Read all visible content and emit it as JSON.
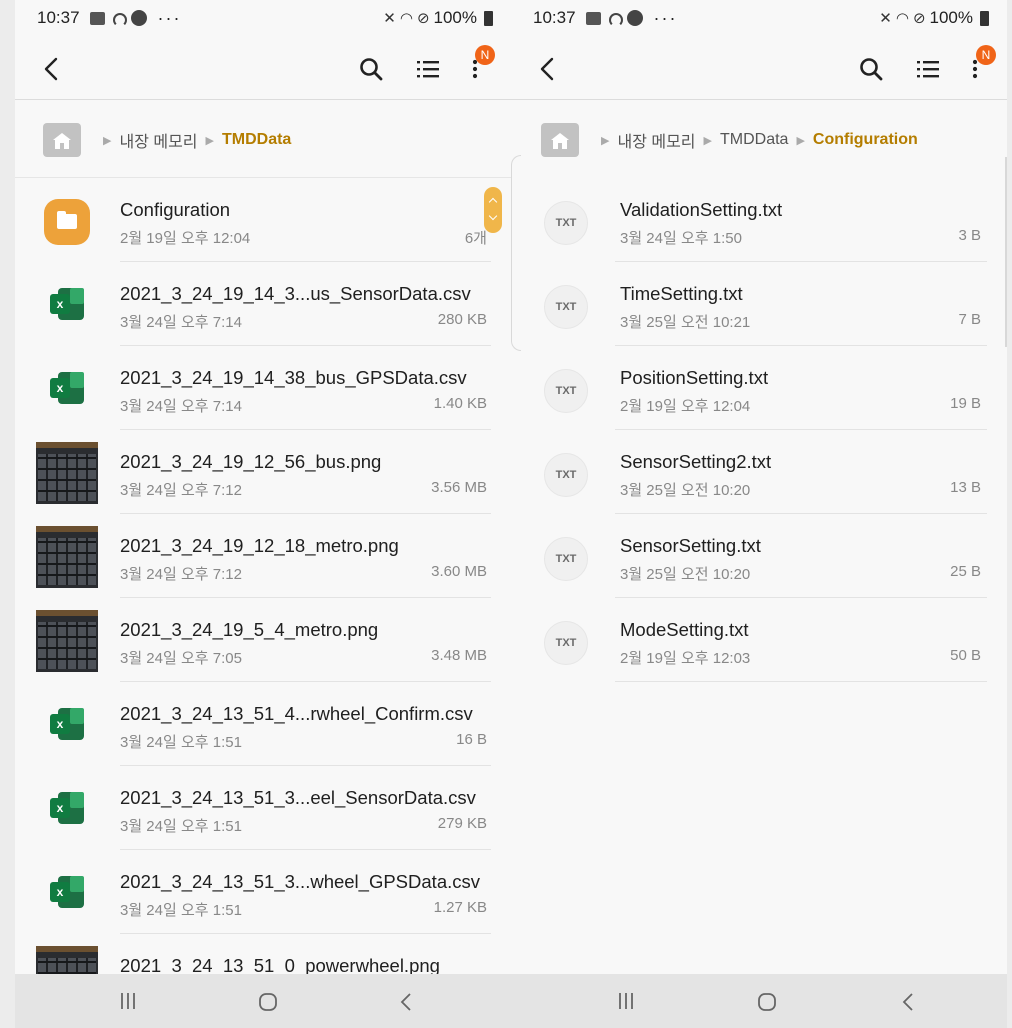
{
  "left": {
    "status": {
      "time": "10:37",
      "battery": "100%"
    },
    "toolbar": {
      "badge": "N"
    },
    "breadcrumb": {
      "root": "내장 메모리",
      "current": "TMDData"
    },
    "files": [
      {
        "type": "folder",
        "name": "Configuration",
        "date": "2월 19일 오후 12:04",
        "size": "6개"
      },
      {
        "type": "excel",
        "name": "2021_3_24_19_14_3...us_SensorData.csv",
        "date": "3월 24일 오후 7:14",
        "size": "280 KB"
      },
      {
        "type": "excel",
        "name": "2021_3_24_19_14_38_bus_GPSData.csv",
        "date": "3월 24일 오후 7:14",
        "size": "1.40 KB"
      },
      {
        "type": "photo",
        "name": "2021_3_24_19_12_56_bus.png",
        "date": "3월 24일 오후 7:12",
        "size": "3.56 MB"
      },
      {
        "type": "photo",
        "name": "2021_3_24_19_12_18_metro.png",
        "date": "3월 24일 오후 7:12",
        "size": "3.60 MB"
      },
      {
        "type": "photo",
        "name": "2021_3_24_19_5_4_metro.png",
        "date": "3월 24일 오후 7:05",
        "size": "3.48 MB"
      },
      {
        "type": "excel",
        "name": "2021_3_24_13_51_4...rwheel_Confirm.csv",
        "date": "3월 24일 오후 1:51",
        "size": "16 B"
      },
      {
        "type": "excel",
        "name": "2021_3_24_13_51_3...eel_SensorData.csv",
        "date": "3월 24일 오후 1:51",
        "size": "279 KB"
      },
      {
        "type": "excel",
        "name": "2021_3_24_13_51_3...wheel_GPSData.csv",
        "date": "3월 24일 오후 1:51",
        "size": "1.27 KB"
      },
      {
        "type": "photo",
        "name": "2021_3_24_13_51_0_powerwheel.png",
        "date": "",
        "size": ""
      }
    ]
  },
  "right": {
    "status": {
      "time": "10:37",
      "battery": "100%"
    },
    "toolbar": {
      "badge": "N"
    },
    "breadcrumb": {
      "root": "내장 메모리",
      "middle": "TMDData",
      "current": "Configuration"
    },
    "txt_label": "TXT",
    "files": [
      {
        "type": "txt",
        "name": "ValidationSetting.txt",
        "date": "3월 24일 오후 1:50",
        "size": "3 B"
      },
      {
        "type": "txt",
        "name": "TimeSetting.txt",
        "date": "3월 25일 오전 10:21",
        "size": "7 B"
      },
      {
        "type": "txt",
        "name": "PositionSetting.txt",
        "date": "2월 19일 오후 12:04",
        "size": "19 B"
      },
      {
        "type": "txt",
        "name": "SensorSetting2.txt",
        "date": "3월 25일 오전 10:20",
        "size": "13 B"
      },
      {
        "type": "txt",
        "name": "SensorSetting.txt",
        "date": "3월 25일 오전 10:20",
        "size": "25 B"
      },
      {
        "type": "txt",
        "name": "ModeSetting.txt",
        "date": "2월 19일 오후 12:03",
        "size": "50 B"
      }
    ]
  },
  "colors": {
    "accent": "#b47d00",
    "folder": "#eda23a",
    "badge": "#f06418",
    "excel": "#1d7044"
  },
  "icons": [
    "back-icon",
    "search-icon",
    "list-view-icon",
    "more-icon",
    "home-icon",
    "recents-icon",
    "home-nav-icon",
    "back-nav-icon"
  ]
}
